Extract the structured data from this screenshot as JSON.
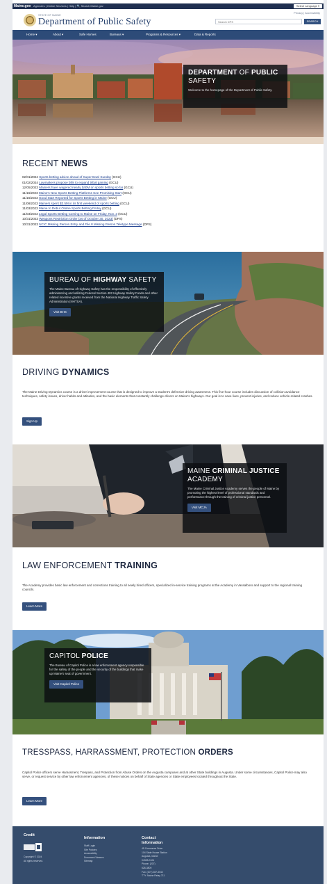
{
  "utility_bar": {
    "brand": "Maine.gov",
    "links": "Agencies | Online Services | Help | 🔍 Search Maine.gov",
    "language_button": "Select Language ▾"
  },
  "header": {
    "state_line": "STATE OF MAINE",
    "title": "Department of Public Safety",
    "links": "Privacy | Accessibility",
    "search_placeholder": "Search DPS",
    "search_button": "SEARCH"
  },
  "nav": {
    "items": [
      "Home ▾",
      "About ▾",
      "Safe Homes",
      "Bureaus ▾",
      "Programs & Resources ▾",
      "Data & Reports"
    ]
  },
  "hero": {
    "title_part1": "DEPARTMENT",
    "title_part2": " OF ",
    "title_part3": "PUBLIC",
    "title_part4": "SAFETY",
    "text": "Welcome to the homepage of the Department of Public Safety."
  },
  "recent_news": {
    "heading_light": "RECENT ",
    "heading_bold": "NEWS",
    "items": [
      {
        "date": "02/01/2024",
        "title": "Sports betting advice ahead of Super Bowl Sunday",
        "source": "(GCU)"
      },
      {
        "date": "01/02/2024",
        "title": "Lawmakers propose bills to expand tribal gaming",
        "source": "(GCU)"
      },
      {
        "date": "12/05/2023",
        "title": "Mainers have wagered nearly $40M on sports betting so far",
        "source": "(GCU)"
      },
      {
        "date": "11/16/2023",
        "title": "Maine's New Sports Betting Platforms See Promising Start",
        "source": "(GCU)"
      },
      {
        "date": "11/16/2023",
        "title": "Good Start Reported for Sports Betting in Maine",
        "source": "(GCU)"
      },
      {
        "date": "11/08/2023",
        "title": "Mainers spent $3.5M in its first weekend of sports betting",
        "source": "(GCU)"
      },
      {
        "date": "11/03/2023",
        "title": "Maine to Debut Online Sports Betting Friday",
        "source": "(GCU)"
      },
      {
        "date": "11/03/2023",
        "title": "Legal Sports Betting Coming to Maine on Friday, Nov. 3",
        "source": "(GCU)"
      },
      {
        "date": "10/31/2023",
        "title": "Weapons Restriction Order (as of October 30, 2023)",
        "source": "(DPS)"
      },
      {
        "date": "10/31/2023",
        "title": "NCIC Missing Person Entry and File 8 Missing Person Teletype Message",
        "source": "(DPS)"
      }
    ]
  },
  "highway": {
    "title_light1": "BUREAU OF ",
    "title_bold": "HIGHWAY",
    "title_light2": " SAFETY",
    "text": "The Maine Bureau of Highway Safety has the responsibility of effectively administering and utilizing Federal Section 402 Highway Safety Funds and other related incentive grants received from the National Highway Traffic Safety Administration (NHTSA).",
    "button": "Visit BHS"
  },
  "driving": {
    "heading_light": "DRIVING ",
    "heading_bold": "DYNAMICS",
    "text": "The Maine Driving Dynamics course is a driver improvement course that is designed to improve a student's defensive driving awareness. This five-hour course includes discussion of collision avoidance techniques, safety issues, driver habits and attitudes, and the basic elements that constantly challenge drivers on Maine's highways. Our goal is to save lives, prevent injuries, and reduce vehicle-related crashes.",
    "button": "Sign Up"
  },
  "academy": {
    "title_light": "MAINE ",
    "title_bold": "CRIMINAL JUSTICE",
    "title_light2": "ACADEMY",
    "text": "The Maine Criminal Justice Academy serves the people of Maine by promoting the highest level of professional standards and performance through the training of criminal justice personnel.",
    "button": "Visit MCJA"
  },
  "training": {
    "heading_light": "LAW ENFORCEMENT ",
    "heading_bold": "TRAINING",
    "text": "The Academy provides basic law enforcement and corrections training to all newly hired officers, specialized in-service training programs at the Academy in Vassalboro and support to the regional training councils.",
    "button": "Learn More"
  },
  "capitol": {
    "title_light": "CAPITOL ",
    "title_bold": "POLICE",
    "text": "The Bureau of Capitol Police is a law enforcement agency responsible for the safety of the people and the security of the buildings that make up Maine's seat of government.",
    "button": "Visit Capitol Police"
  },
  "orders": {
    "heading_light": "TRESSPASS, HARRASSMENT, PROTECTION ",
    "heading_bold": "ORDERS",
    "text": "Capitol Police officers serve Harassment, Trespass, and Protection from Abuse Orders on the Augusta campuses and at other State buildings in Augusta. Under some circumstances, Capitol Police may also serve, or request service by other law enforcement agencies, of these notices on behalf of State agencies or State employees located throughout the State.",
    "button": "Learn More"
  },
  "footer": {
    "col1_heading": "Credit",
    "col1_text": "Copyright © 2024 All rights reserved.",
    "col2_heading": "Information",
    "col2_links": [
      "Staff Login",
      "Site Policies",
      "Accessibility",
      "Document Viewers",
      "Sitemap"
    ],
    "col3_heading": "Contact Information",
    "col3_lines": [
      "45 Commerce Drive",
      "104 State House Station",
      "Augusta, Maine",
      "04333-0104",
      "Phone: (207)",
      "626-3800",
      "Fax: (207) 287-3042",
      "TTY: Maine Relay 711"
    ]
  },
  "colors": {
    "primary": "#2d4b78",
    "button": "#34507d",
    "footer": "#354c6c",
    "link": "#1d3f8f"
  }
}
